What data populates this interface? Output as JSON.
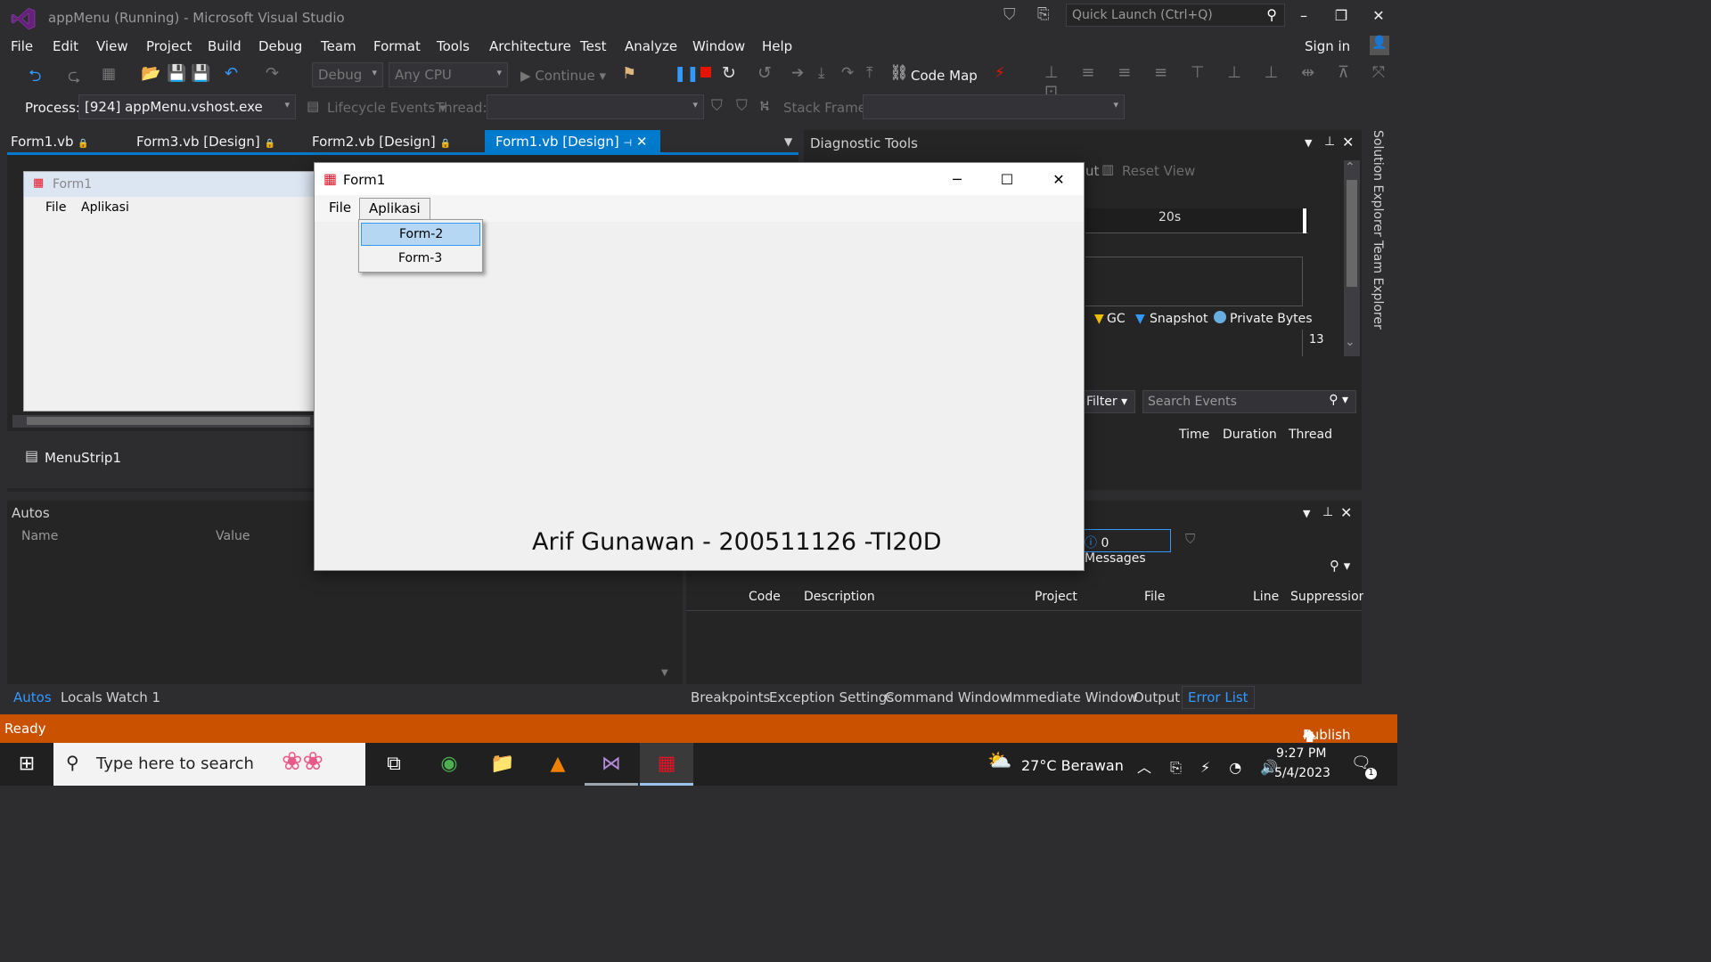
{
  "window": {
    "title": "appMenu (Running) - Microsoft Visual Studio",
    "quick_launch_placeholder": "Quick Launch (Ctrl+Q)",
    "sign_in": "Sign in"
  },
  "menu": [
    "File",
    "Edit",
    "View",
    "Project",
    "Build",
    "Debug",
    "Team",
    "Format",
    "Tools",
    "Architecture",
    "Test",
    "Analyze",
    "Window",
    "Help"
  ],
  "toolbar": {
    "config": "Debug",
    "platform": "Any CPU",
    "continue": "Continue",
    "code_map": "Code Map"
  },
  "process_bar": {
    "process_label": "Process:",
    "process_value": "[924] appMenu.vshost.exe",
    "lifecycle": "Lifecycle Events",
    "thread_label": "Thread:",
    "stack_label": "Stack Frame:"
  },
  "doc_tabs": [
    {
      "label": "Form1.vb",
      "active": false
    },
    {
      "label": "Form3.vb [Design]",
      "active": false
    },
    {
      "label": "Form2.vb [Design]",
      "active": false
    },
    {
      "label": "Form1.vb [Design]",
      "active": true
    }
  ],
  "designer": {
    "form_title": "Form1",
    "menu_items": [
      "File",
      "Aplikasi"
    ],
    "tray_component": "MenuStrip1"
  },
  "autos": {
    "title": "Autos",
    "col_name": "Name",
    "col_value": "Value",
    "tabs": [
      "Autos",
      "Locals",
      "Watch 1"
    ]
  },
  "diagnostic": {
    "title": "Diagnostic Tools",
    "reset_view": "Reset View",
    "partial_label": "ut",
    "timeline_label": "20s",
    "legend": [
      "GC",
      "Snapshot",
      "Private Bytes"
    ],
    "value_13": "13",
    "filter": "Filter",
    "search_events": "Search Events",
    "cols": [
      "Time",
      "Duration",
      "Thread"
    ]
  },
  "error_list": {
    "messages": "0 Messages",
    "cols": [
      "Code",
      "Description",
      "Project",
      "File",
      "Line",
      "Suppression"
    ],
    "tabs": [
      "Breakpoints",
      "Exception Settings",
      "Command Window",
      "Immediate Window",
      "Output",
      "Error List"
    ]
  },
  "status": {
    "ready": "Ready",
    "publish": "Publish"
  },
  "side_tabs": [
    "Solution Explorer",
    "Team Explorer"
  ],
  "running_form": {
    "title": "Form1",
    "menu": [
      "File",
      "Aplikasi"
    ],
    "dropdown": [
      "Form-2",
      "Form-3"
    ],
    "label": "Arif Gunawan - 200511126 -TI20D"
  },
  "taskbar": {
    "search_placeholder": "Type here to search",
    "weather": "27°C  Berawan",
    "time": "9:27 PM",
    "date": "5/4/2023",
    "notifications": "1"
  },
  "colors": {
    "accent": "#007acc",
    "status": "#ca5100",
    "dropdown_highlight": "#b5d7f3"
  }
}
